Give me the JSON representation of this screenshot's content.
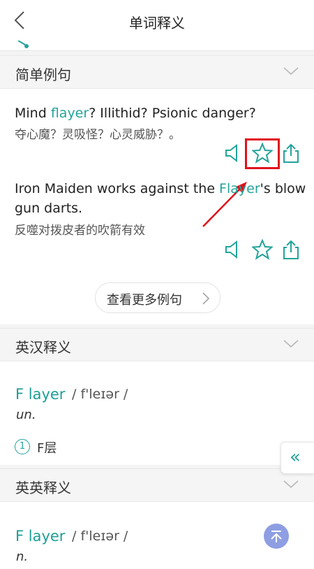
{
  "header": {
    "title": "单词释义"
  },
  "simple_examples": {
    "title": "简单例句",
    "examples": [
      {
        "en_before": "Mind ",
        "en_highlight": "flayer",
        "en_after": "? Illithid? Psionic danger?",
        "zh": "夺心魔？灵吸怪？心灵威胁？。"
      },
      {
        "en_before": "Iron Maiden works against the ",
        "en_highlight": "Flayer",
        "en_after": "'s blow gun darts.",
        "zh": "反噬对拨皮者的吹箭有效"
      }
    ],
    "more_label": "查看更多例句"
  },
  "en_cn": {
    "title": "英汉释义",
    "word": "F layer",
    "phonetic": "/ f'leɪər /",
    "pos": "un.",
    "sense_number": "1",
    "sense_text": "F层"
  },
  "en_en": {
    "title": "英英释义",
    "word": "F layer",
    "phonetic": "/ f'leɪər /",
    "pos": "n."
  },
  "side_tab_glyph": "«",
  "colors": {
    "accent": "#23a39a",
    "highlight_box": "#e0121b",
    "to_top": "#8e9ee2"
  }
}
